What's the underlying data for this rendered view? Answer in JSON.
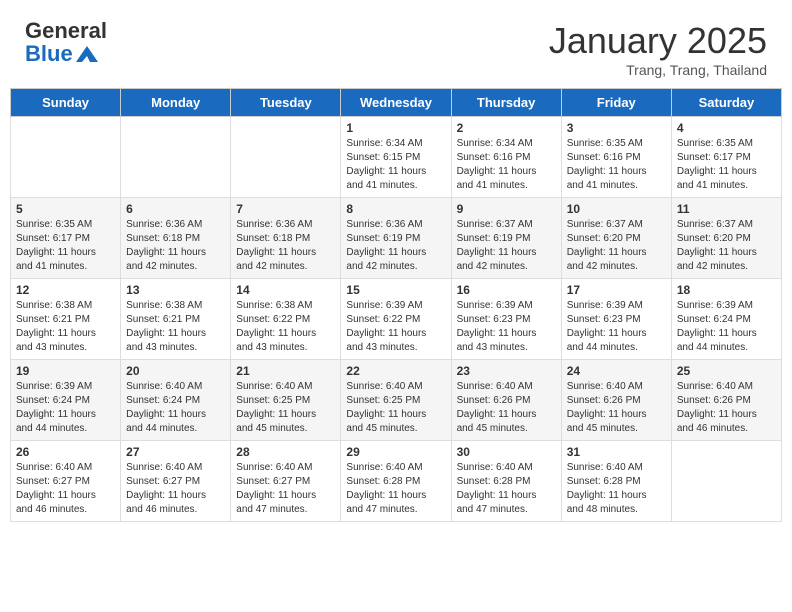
{
  "header": {
    "logo_general": "General",
    "logo_blue": "Blue",
    "month_title": "January 2025",
    "location": "Trang, Trang, Thailand"
  },
  "days_of_week": [
    "Sunday",
    "Monday",
    "Tuesday",
    "Wednesday",
    "Thursday",
    "Friday",
    "Saturday"
  ],
  "weeks": [
    [
      {
        "day": "",
        "info": ""
      },
      {
        "day": "",
        "info": ""
      },
      {
        "day": "",
        "info": ""
      },
      {
        "day": "1",
        "info": "Sunrise: 6:34 AM\nSunset: 6:15 PM\nDaylight: 11 hours and 41 minutes."
      },
      {
        "day": "2",
        "info": "Sunrise: 6:34 AM\nSunset: 6:16 PM\nDaylight: 11 hours and 41 minutes."
      },
      {
        "day": "3",
        "info": "Sunrise: 6:35 AM\nSunset: 6:16 PM\nDaylight: 11 hours and 41 minutes."
      },
      {
        "day": "4",
        "info": "Sunrise: 6:35 AM\nSunset: 6:17 PM\nDaylight: 11 hours and 41 minutes."
      }
    ],
    [
      {
        "day": "5",
        "info": "Sunrise: 6:35 AM\nSunset: 6:17 PM\nDaylight: 11 hours and 41 minutes."
      },
      {
        "day": "6",
        "info": "Sunrise: 6:36 AM\nSunset: 6:18 PM\nDaylight: 11 hours and 42 minutes."
      },
      {
        "day": "7",
        "info": "Sunrise: 6:36 AM\nSunset: 6:18 PM\nDaylight: 11 hours and 42 minutes."
      },
      {
        "day": "8",
        "info": "Sunrise: 6:36 AM\nSunset: 6:19 PM\nDaylight: 11 hours and 42 minutes."
      },
      {
        "day": "9",
        "info": "Sunrise: 6:37 AM\nSunset: 6:19 PM\nDaylight: 11 hours and 42 minutes."
      },
      {
        "day": "10",
        "info": "Sunrise: 6:37 AM\nSunset: 6:20 PM\nDaylight: 11 hours and 42 minutes."
      },
      {
        "day": "11",
        "info": "Sunrise: 6:37 AM\nSunset: 6:20 PM\nDaylight: 11 hours and 42 minutes."
      }
    ],
    [
      {
        "day": "12",
        "info": "Sunrise: 6:38 AM\nSunset: 6:21 PM\nDaylight: 11 hours and 43 minutes."
      },
      {
        "day": "13",
        "info": "Sunrise: 6:38 AM\nSunset: 6:21 PM\nDaylight: 11 hours and 43 minutes."
      },
      {
        "day": "14",
        "info": "Sunrise: 6:38 AM\nSunset: 6:22 PM\nDaylight: 11 hours and 43 minutes."
      },
      {
        "day": "15",
        "info": "Sunrise: 6:39 AM\nSunset: 6:22 PM\nDaylight: 11 hours and 43 minutes."
      },
      {
        "day": "16",
        "info": "Sunrise: 6:39 AM\nSunset: 6:23 PM\nDaylight: 11 hours and 43 minutes."
      },
      {
        "day": "17",
        "info": "Sunrise: 6:39 AM\nSunset: 6:23 PM\nDaylight: 11 hours and 44 minutes."
      },
      {
        "day": "18",
        "info": "Sunrise: 6:39 AM\nSunset: 6:24 PM\nDaylight: 11 hours and 44 minutes."
      }
    ],
    [
      {
        "day": "19",
        "info": "Sunrise: 6:39 AM\nSunset: 6:24 PM\nDaylight: 11 hours and 44 minutes."
      },
      {
        "day": "20",
        "info": "Sunrise: 6:40 AM\nSunset: 6:24 PM\nDaylight: 11 hours and 44 minutes."
      },
      {
        "day": "21",
        "info": "Sunrise: 6:40 AM\nSunset: 6:25 PM\nDaylight: 11 hours and 45 minutes."
      },
      {
        "day": "22",
        "info": "Sunrise: 6:40 AM\nSunset: 6:25 PM\nDaylight: 11 hours and 45 minutes."
      },
      {
        "day": "23",
        "info": "Sunrise: 6:40 AM\nSunset: 6:26 PM\nDaylight: 11 hours and 45 minutes."
      },
      {
        "day": "24",
        "info": "Sunrise: 6:40 AM\nSunset: 6:26 PM\nDaylight: 11 hours and 45 minutes."
      },
      {
        "day": "25",
        "info": "Sunrise: 6:40 AM\nSunset: 6:26 PM\nDaylight: 11 hours and 46 minutes."
      }
    ],
    [
      {
        "day": "26",
        "info": "Sunrise: 6:40 AM\nSunset: 6:27 PM\nDaylight: 11 hours and 46 minutes."
      },
      {
        "day": "27",
        "info": "Sunrise: 6:40 AM\nSunset: 6:27 PM\nDaylight: 11 hours and 46 minutes."
      },
      {
        "day": "28",
        "info": "Sunrise: 6:40 AM\nSunset: 6:27 PM\nDaylight: 11 hours and 47 minutes."
      },
      {
        "day": "29",
        "info": "Sunrise: 6:40 AM\nSunset: 6:28 PM\nDaylight: 11 hours and 47 minutes."
      },
      {
        "day": "30",
        "info": "Sunrise: 6:40 AM\nSunset: 6:28 PM\nDaylight: 11 hours and 47 minutes."
      },
      {
        "day": "31",
        "info": "Sunrise: 6:40 AM\nSunset: 6:28 PM\nDaylight: 11 hours and 48 minutes."
      },
      {
        "day": "",
        "info": ""
      }
    ]
  ]
}
